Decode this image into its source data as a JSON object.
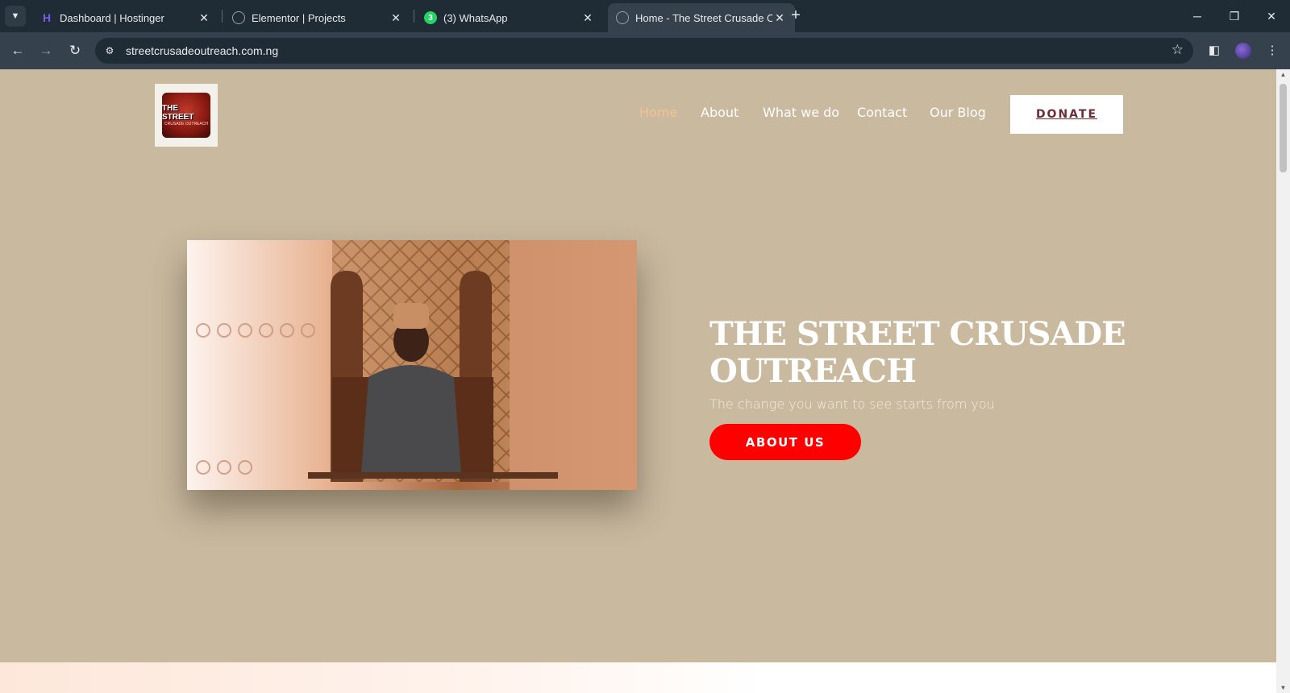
{
  "browser": {
    "tabs": [
      {
        "title": "Dashboard | Hostinger",
        "icon": "hostinger-icon",
        "active": false
      },
      {
        "title": "Elementor | Projects",
        "icon": "globe-icon",
        "active": false
      },
      {
        "title": "(3) WhatsApp",
        "icon": "whatsapp-icon",
        "active": false,
        "badge": "3"
      },
      {
        "title": "Home - The Street Crusade Out",
        "icon": "globe-icon",
        "active": true
      }
    ],
    "url": "streetcrusadeoutreach.com.ng",
    "colors": {
      "tabstrip": "#1f2b35",
      "toolbar": "#35414c"
    }
  },
  "site": {
    "logo": {
      "line1": "THE STREET",
      "line2": "CRUSADE OUTREACH"
    },
    "nav": [
      {
        "label": "Home",
        "current": true
      },
      {
        "label": "About",
        "current": false
      },
      {
        "label": "What we do",
        "current": false
      },
      {
        "label": "Contact",
        "current": false
      },
      {
        "label": "Our Blog",
        "current": false
      }
    ],
    "donate_label": "DONATE",
    "hero": {
      "title": "THE STREET CRUSADE OUTREACH",
      "subtitle": "The change you want to see starts from you",
      "button_label": "ABOUT US"
    },
    "colors": {
      "background": "#c8b99f",
      "accent_nav": "#f6c28e",
      "button": "#ff0000",
      "donate_text": "#6a2c36"
    }
  }
}
